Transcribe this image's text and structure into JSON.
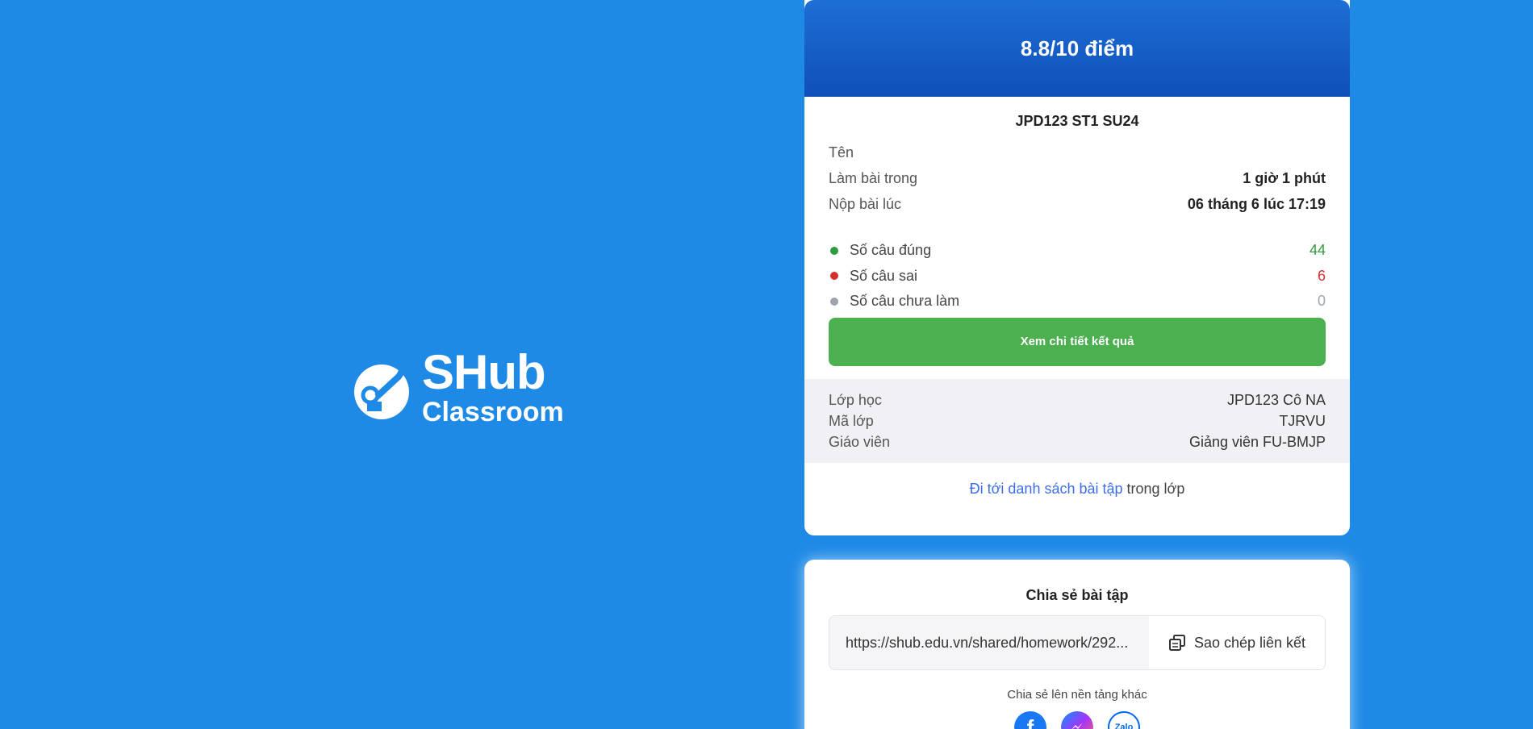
{
  "brand": {
    "title": "SHub",
    "subtitle": "Classroom"
  },
  "result": {
    "score": "8.8/10 điểm",
    "assignment_title": "JPD123 ST1 SU24",
    "name_label": "Tên",
    "name_value": "",
    "duration_label": "Làm bài trong",
    "duration_value": "1 giờ 1 phút",
    "submitted_label": "Nộp bài lúc",
    "submitted_value": "06 tháng 6 lúc 17:19",
    "stats": [
      {
        "label": "Số câu đúng",
        "value": "44",
        "color": "#2e9b3e"
      },
      {
        "label": "Số câu sai",
        "value": "6",
        "color": "#d32f2f"
      },
      {
        "label": "Số câu chưa làm",
        "value": "0",
        "color": "#9ea3ad"
      }
    ],
    "detail_button": "Xem chi tiết kết quả",
    "class_label": "Lớp học",
    "class_value": "JPD123 Cô NA",
    "code_label": "Mã lớp",
    "code_value": "TJRVU",
    "teacher_label": "Giáo viên",
    "teacher_value": "Giảng viên FU-BMJP",
    "goto_link": "Đi tới danh sách bài tập",
    "goto_suffix": " trong lớp"
  },
  "share": {
    "title": "Chia sẻ bài tập",
    "url": "https://shub.edu.vn/shared/homework/292...",
    "copy_button": "Sao chép liên kết",
    "other_label": "Chia sẻ lên nền tảng khác",
    "platforms": [
      {
        "icon": "facebook-icon",
        "label": "f"
      },
      {
        "icon": "messenger-icon",
        "label": ""
      },
      {
        "icon": "zalo-icon",
        "label": "Zalo"
      }
    ]
  },
  "colors": {
    "background": "#1f8ae6",
    "header": "#1d6fd6",
    "accent_green": "#4caf50",
    "link": "#3c6ee8"
  }
}
